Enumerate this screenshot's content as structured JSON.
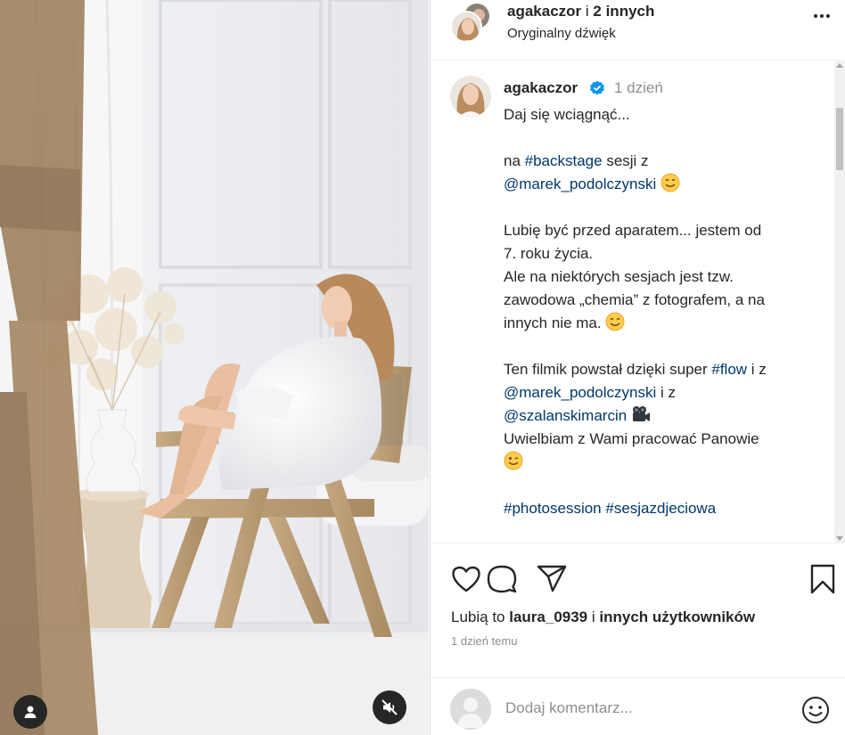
{
  "header": {
    "username": "agakaczor",
    "separator": " i ",
    "others": "2 innych",
    "audio": "Oryginalny dźwięk"
  },
  "caption": {
    "username": "agakaczor",
    "time": "1 dzień",
    "line1": "Daj się wciągnąć...",
    "line2_pre": "na ",
    "hashtag_backstage": "#backstage",
    "line2_post": " sesji z",
    "mention1": "@marek_podolczynski",
    "line3a": "Lubię być przed aparatem... jestem od",
    "line3b": "7. roku życia.",
    "line3c": "Ale na niektórych sesjach jest tzw.",
    "line3d": "zawodowa „chemia” z fotografem, a na",
    "line3e": "innych nie ma.",
    "line4_pre": "Ten filmik powstał dzięki super ",
    "hashtag_flow": "#flow",
    "line4_post": " i z",
    "mention2": "@marek_podolczynski",
    "line5_post": " i z",
    "mention3": "@szalanskimarcin",
    "line6": "Uwielbiam z Wami pracować Panowie",
    "hashtag_photosession": "#photosession",
    "hashtag_sesja": "#sesjazdjeciowa"
  },
  "actions": {
    "like_icon": "heart-icon",
    "comment_icon": "comment-icon",
    "share_icon": "send-icon",
    "save_icon": "bookmark-icon"
  },
  "likes": {
    "prefix": "Lubią to ",
    "user": "laura_0939",
    "middle": " i ",
    "rest": "innych użytkowników"
  },
  "date": "1 dzień temu",
  "comment": {
    "placeholder": "Dodaj komentarz..."
  },
  "colors": {
    "link": "#00376b",
    "text": "#262626",
    "muted": "#8e8e8e",
    "verified": "#0095f6"
  }
}
